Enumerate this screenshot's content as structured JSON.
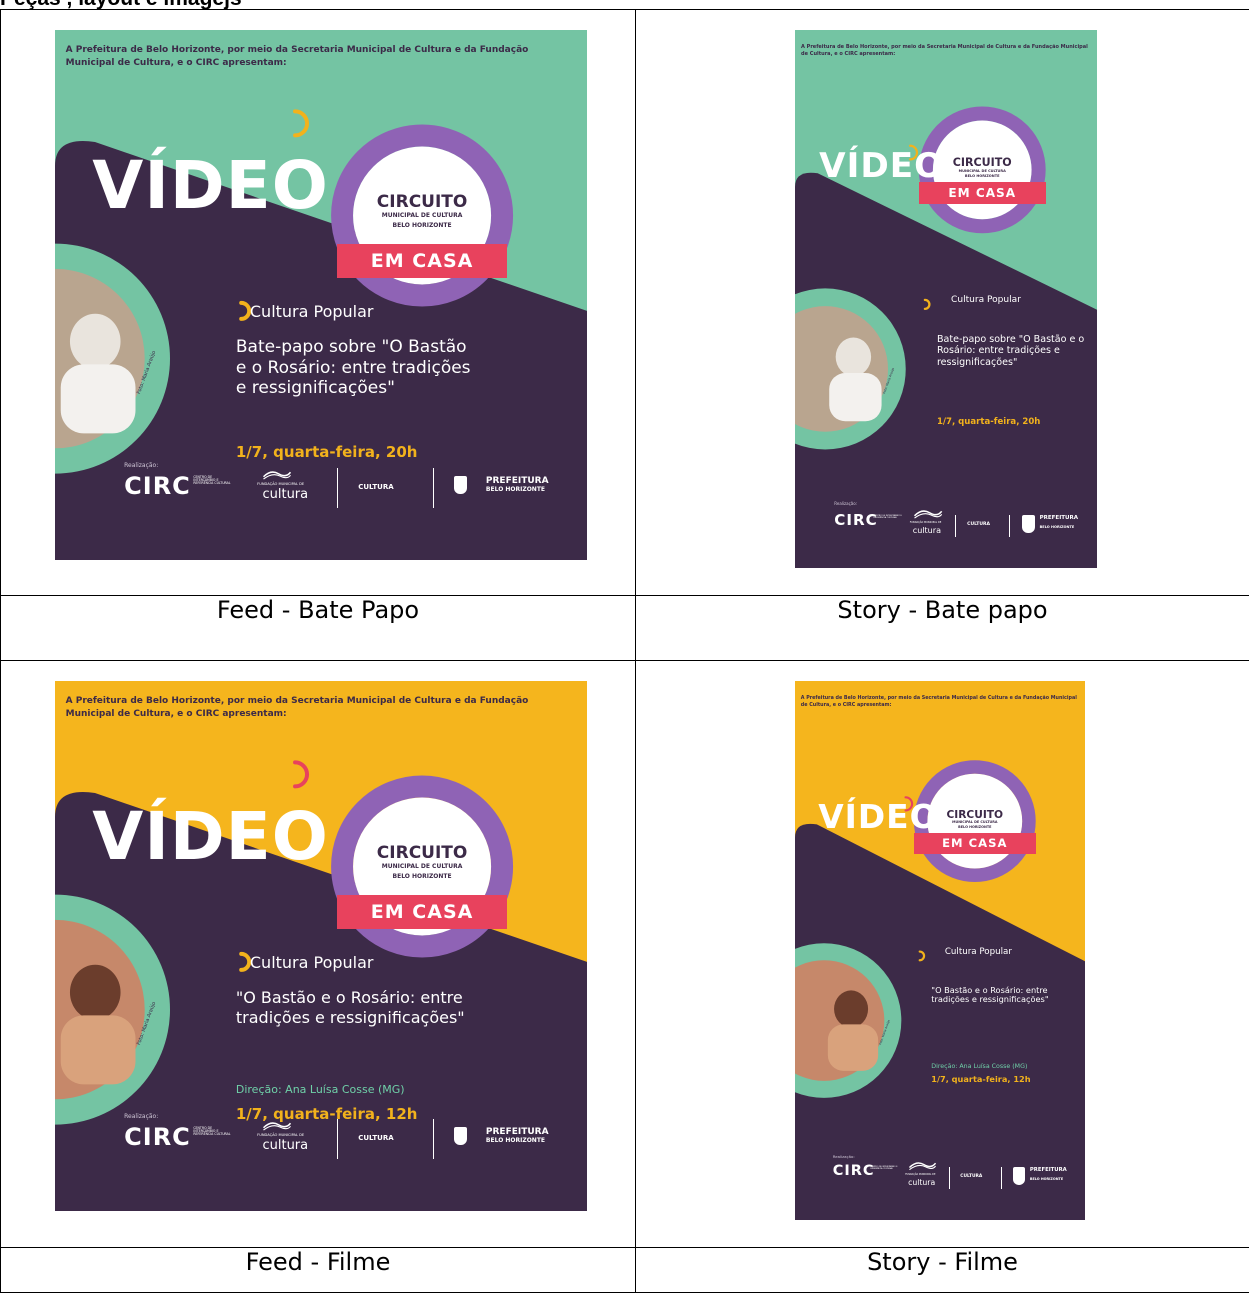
{
  "heading": "Peças , layout e imagejs",
  "colors": {
    "purple": "#3c2a48",
    "teal": "#74c4a3",
    "yellow": "#f5b51d",
    "ring": "#8f63b5",
    "pink": "#e8425d",
    "orange": "#f2b21c",
    "white": "#ffffff"
  },
  "posters": [
    {
      "id": "feed-bate-papo",
      "format": "feed",
      "theme": "teal",
      "intro": "A Prefeitura de Belo Horizonte, por meio da Secretaria Municipal de Cultura e da Fundação Municipal de Cultura, e o CIRC apresentam:",
      "video": "VÍDEO",
      "ring_title": "CIRCUITO",
      "ring_sub1": "MUNICIPAL DE CULTURA",
      "ring_sub2": "BELO HORIZONTE",
      "em_casa": "EM CASA",
      "topic": "Cultura Popular",
      "title": "Bate-papo sobre \"O Bastão e o Rosário: entre tradições e ressignificações\"",
      "direcao": "",
      "date": "1/7, quarta-feira, 20h",
      "credit": "Foto: Maria Araújo",
      "realizacao": "Realização:",
      "logo_circ": "CIRC",
      "logo_circ_sub": "CENTRO DE INTERCÂMBIO E REFERÊNCIA CULTURAL",
      "logo_fmc_line": "FUNDAÇÃO MUNICIPAL DE",
      "logo_fmc": "cultura",
      "logo_cultura": "CULTURA",
      "logo_pbh1": "PREFEITURA",
      "logo_pbh2": "BELO HORIZONTE"
    },
    {
      "id": "story-bate-papo",
      "format": "story",
      "theme": "teal",
      "intro": "A Prefeitura de Belo Horizonte, por meio da Secretaria Municipal de Cultura e da Fundação Municipal de Cultura, e o CIRC apresentam:",
      "video": "VÍDEO",
      "ring_title": "CIRCUITO",
      "ring_sub1": "MUNICIPAL DE CULTURA",
      "ring_sub2": "BELO HORIZONTE",
      "em_casa": "EM CASA",
      "topic": "Cultura Popular",
      "title": "Bate-papo sobre \"O Bastão e o Rosário: entre tradições e ressignificações\"",
      "direcao": "",
      "date": "1/7, quarta-feira, 20h",
      "credit": "Foto: Maria Araújo",
      "realizacao": "Realização:",
      "logo_circ": "CIRC",
      "logo_circ_sub": "CENTRO DE INTERCÂMBIO E REFERÊNCIA CULTURAL",
      "logo_fmc_line": "FUNDAÇÃO MUNICIPAL DE",
      "logo_fmc": "cultura",
      "logo_cultura": "CULTURA",
      "logo_pbh1": "PREFEITURA",
      "logo_pbh2": "BELO HORIZONTE"
    },
    {
      "id": "feed-filme",
      "format": "feed",
      "theme": "yellow",
      "intro": "A Prefeitura de Belo Horizonte, por meio da Secretaria Municipal de Cultura e da Fundação Municipal de Cultura, e o CIRC apresentam:",
      "video": "VÍDEO",
      "ring_title": "CIRCUITO",
      "ring_sub1": "MUNICIPAL DE CULTURA",
      "ring_sub2": "BELO HORIZONTE",
      "em_casa": "EM CASA",
      "topic": "Cultura Popular",
      "title": "\"O Bastão e o Rosário: entre tradições e ressignificações\"",
      "direcao": "Direção: Ana Luísa Cosse (MG)",
      "date": "1/7, quarta-feira, 12h",
      "credit": "Foto: Maria Araújo",
      "realizacao": "Realização:",
      "logo_circ": "CIRC",
      "logo_circ_sub": "CENTRO DE INTERCÂMBIO E REFERÊNCIA CULTURAL",
      "logo_fmc_line": "FUNDAÇÃO MUNICIPAL DE",
      "logo_fmc": "cultura",
      "logo_cultura": "CULTURA",
      "logo_pbh1": "PREFEITURA",
      "logo_pbh2": "BELO HORIZONTE"
    },
    {
      "id": "story-filme",
      "format": "story",
      "theme": "yellow",
      "intro": "A Prefeitura de Belo Horizonte, por meio da Secretaria Municipal de Cultura e da Fundação Municipal de Cultura, e o CIRC apresentam:",
      "video": "VÍDEO",
      "ring_title": "CIRCUITO",
      "ring_sub1": "MUNICIPAL DE CULTURA",
      "ring_sub2": "BELO HORIZONTE",
      "em_casa": "EM CASA",
      "topic": "Cultura Popular",
      "title": "\"O Bastão e o Rosário: entre tradições e ressignificações\"",
      "direcao": "Direção: Ana Luísa Cosse (MG)",
      "date": "1/7, quarta-feira, 12h",
      "credit": "Foto: Maria Araújo",
      "realizacao": "Realização:",
      "logo_circ": "CIRC",
      "logo_circ_sub": "CENTRO DE INTERCÂMBIO E REFERÊNCIA CULTURAL",
      "logo_fmc_line": "FUNDAÇÃO MUNICIPAL DE",
      "logo_fmc": "cultura",
      "logo_cultura": "CULTURA",
      "logo_pbh1": "PREFEITURA",
      "logo_pbh2": "BELO HORIZONTE"
    }
  ],
  "captions": [
    "Feed - Bate Papo",
    "Story - Bate papo",
    "Feed - Filme",
    "Story - Filme"
  ]
}
